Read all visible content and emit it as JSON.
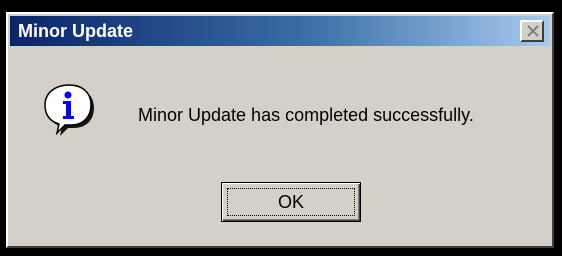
{
  "dialog": {
    "title": "Minor Update",
    "message": "Minor Update has completed successfully.",
    "ok_label": "OK",
    "icon": "info-icon",
    "close_icon": "close-icon"
  },
  "colors": {
    "titlebar_start": "#0a246a",
    "titlebar_end": "#a6caf0",
    "dialog_face": "#d4d0c8",
    "icon_blue": "#0000ff"
  }
}
